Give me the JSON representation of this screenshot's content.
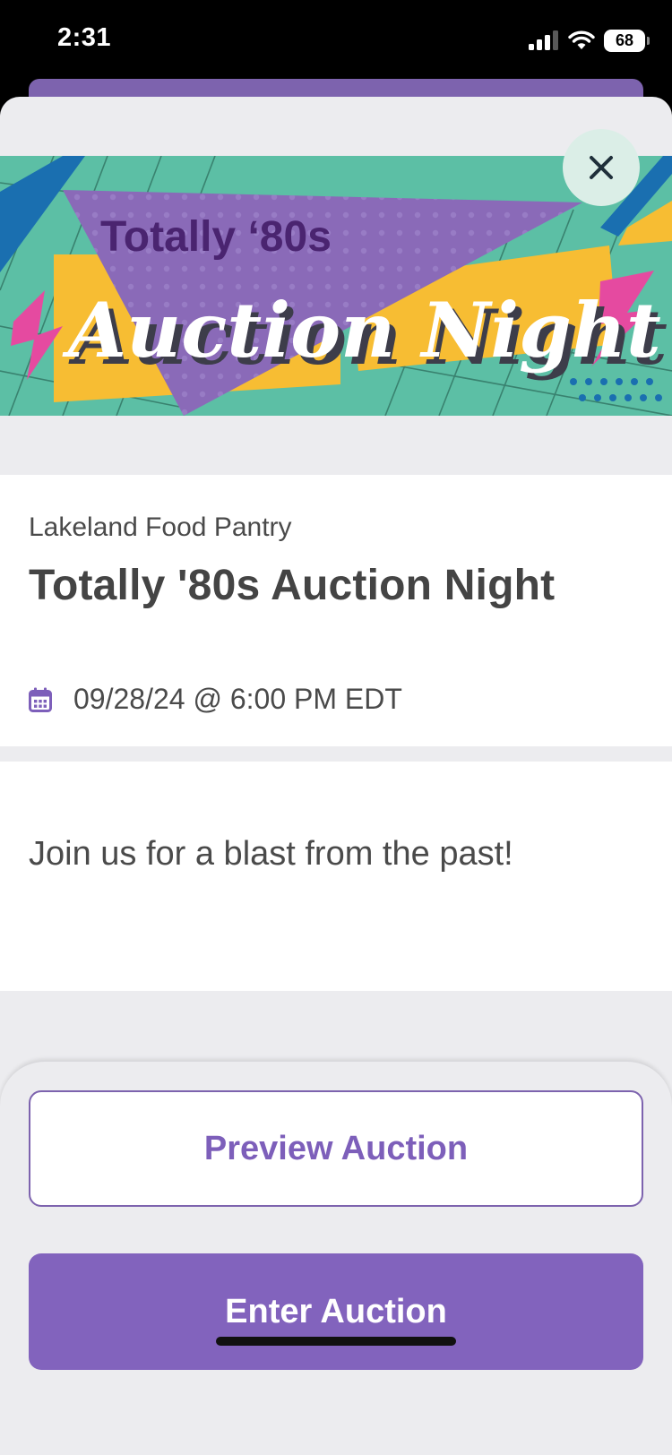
{
  "status_bar": {
    "time": "2:31",
    "battery": "68",
    "icons": [
      "signal-icon",
      "wifi-icon",
      "battery-icon"
    ]
  },
  "banner": {
    "line1": "Totally ‘80s",
    "line2": "Auction Night",
    "colors": {
      "teal": "#5cbfa5",
      "purple": "#8a6ab8",
      "yellow": "#f7bd33",
      "pink": "#e54aa0",
      "blue": "#1a6fb0",
      "dark_purple": "#4a2470"
    }
  },
  "close_icon": "close-icon",
  "event": {
    "organization": "Lakeland Food Pantry",
    "title": "Totally '80s Auction Night",
    "date": "09/28/24 @ 6:00 PM EDT",
    "date_icon": "calendar-icon"
  },
  "description": "Join us for a blast from the past!",
  "actions": {
    "preview_label": "Preview Auction",
    "enter_label": "Enter Auction"
  },
  "theme": {
    "accent": "#8263bd",
    "text": "#4a4a4a",
    "background": "#ececef"
  }
}
